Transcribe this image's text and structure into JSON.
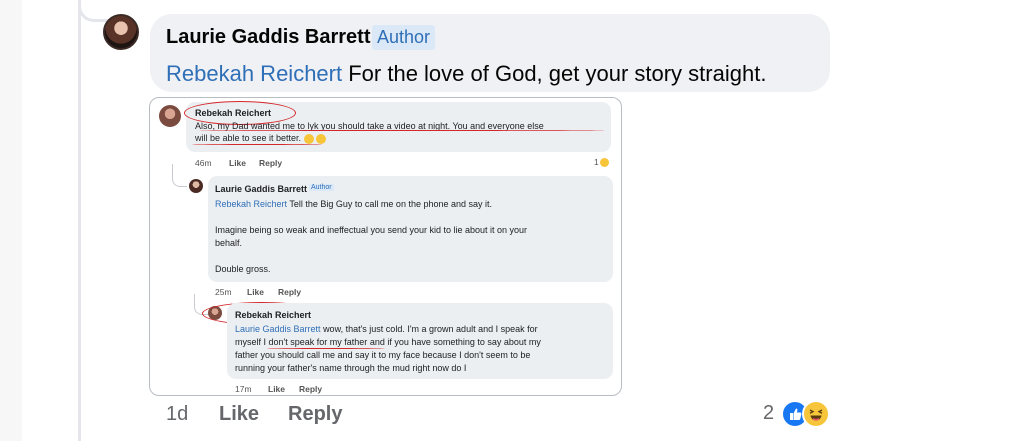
{
  "main_comment": {
    "author": "Laurie Gaddis Barrett",
    "badge": "Author",
    "mention": "Rebekah Reichert",
    "text": "For the love of God, get your story straight.",
    "time": "1d",
    "like_label": "Like",
    "reply_label": "Reply",
    "reaction_count": "2",
    "reaction_icons": [
      "like-icon",
      "haha-icon"
    ]
  },
  "embedded_screenshot": {
    "comment1": {
      "author": "Rebekah Reichert",
      "line1": "Also, my Dad wanted me to lyk you should take a video at night. You and everyone else",
      "line2": "will be able to see it better.",
      "time": "46m",
      "like_label": "Like",
      "reply_label": "Reply",
      "reaction_count": "1"
    },
    "comment2": {
      "author": "Laurie Gaddis Barrett",
      "badge": "Author",
      "mention": "Rebekah Reichert",
      "line1": "Tell the Big Guy to call me on the phone and say it.",
      "line2": "Imagine being so weak and ineffectual you send your kid to lie about it on your",
      "line3": "behalf.",
      "line4": "Double gross.",
      "time": "25m",
      "like_label": "Like",
      "reply_label": "Reply"
    },
    "comment3": {
      "author": "Rebekah Reichert",
      "mention": "Laurie Gaddis Barrett",
      "line1": "wow, that's just cold.  I'm a grown adult and I speak for",
      "line2a": "myself",
      "line2b": "I don't speak for my father",
      "line2c": "and if you have something to say about my",
      "line3": "father you should call me and say it to my face because I don't seem to be",
      "line4": "running your father's name through the mud right now do I",
      "time": "17m",
      "like_label": "Like",
      "reply_label": "Reply"
    }
  }
}
